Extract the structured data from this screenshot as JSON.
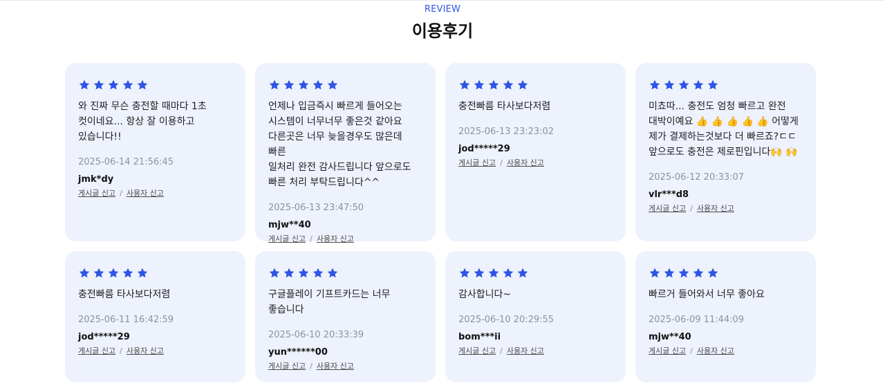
{
  "header": {
    "eyebrow": "REVIEW",
    "title": "이용후기"
  },
  "colors": {
    "accent": "#2f55e4",
    "card_bg": "#eef2fd"
  },
  "star_icon": "star-icon",
  "reviews": [
    {
      "rating": 5,
      "text": "와 진짜 무슨 충전할 때마다 1초\n컷이네요... 항상 잘 이용하고\n있습니다!!",
      "date": "2025-06-14 21:56:45",
      "user": "jmk*dy",
      "report_post": "게시글 신고",
      "sep": "/",
      "report_user": "사용자 신고"
    },
    {
      "rating": 5,
      "text": "언제나 입금즉시 빠르게 들어오는\n시스템이 너무너무 좋은것 같아요\n다른곳은 너무 늦을경우도 많은데 빠른\n일처리 완전 감사드립니다 앞으로도\n빠른 처리 부탁드립니다^^",
      "date": "2025-06-13 23:47:50",
      "user": "mjw**40",
      "report_post": "게시글 신고",
      "sep": "/",
      "report_user": "사용자 신고"
    },
    {
      "rating": 5,
      "text": "충전빠름 타사보다저렴",
      "date": "2025-06-13 23:23:02",
      "user": "jod*****29",
      "report_post": "게시글 신고",
      "sep": "/",
      "report_user": "사용자 신고"
    },
    {
      "rating": 5,
      "text": "미쵸따... 충전도 엄청 빠르고 완전\n대박이예요 👍 👍 👍 👍 👍 어떻게\n제가 결제하는것보다 더 빠르죠?ㄷㄷ\n앞으로도 충전은 제로핀입니다🙌 🙌",
      "date": "2025-06-12 20:33:07",
      "user": "vlr***d8",
      "report_post": "게시글 신고",
      "sep": "/",
      "report_user": "사용자 신고"
    },
    {
      "rating": 5,
      "text": "충전빠름 타사보다저렴",
      "date": "2025-06-11 16:42:59",
      "user": "jod*****29",
      "report_post": "게시글 신고",
      "sep": "/",
      "report_user": "사용자 신고"
    },
    {
      "rating": 5,
      "text": "구글플레이 기프트카드는 너무\n좋습니다",
      "date": "2025-06-10 20:33:39",
      "user": "yun******00",
      "report_post": "게시글 신고",
      "sep": "/",
      "report_user": "사용자 신고"
    },
    {
      "rating": 5,
      "text": "감사합니다~",
      "date": "2025-06-10 20:29:55",
      "user": "bom***ii",
      "report_post": "게시글 신고",
      "sep": "/",
      "report_user": "사용자 신고"
    },
    {
      "rating": 5,
      "text": "빠르거 들어와서 너무 좋아요",
      "date": "2025-06-09 11:44:09",
      "user": "mjw**40",
      "report_post": "게시글 신고",
      "sep": "/",
      "report_user": "사용자 신고"
    }
  ]
}
